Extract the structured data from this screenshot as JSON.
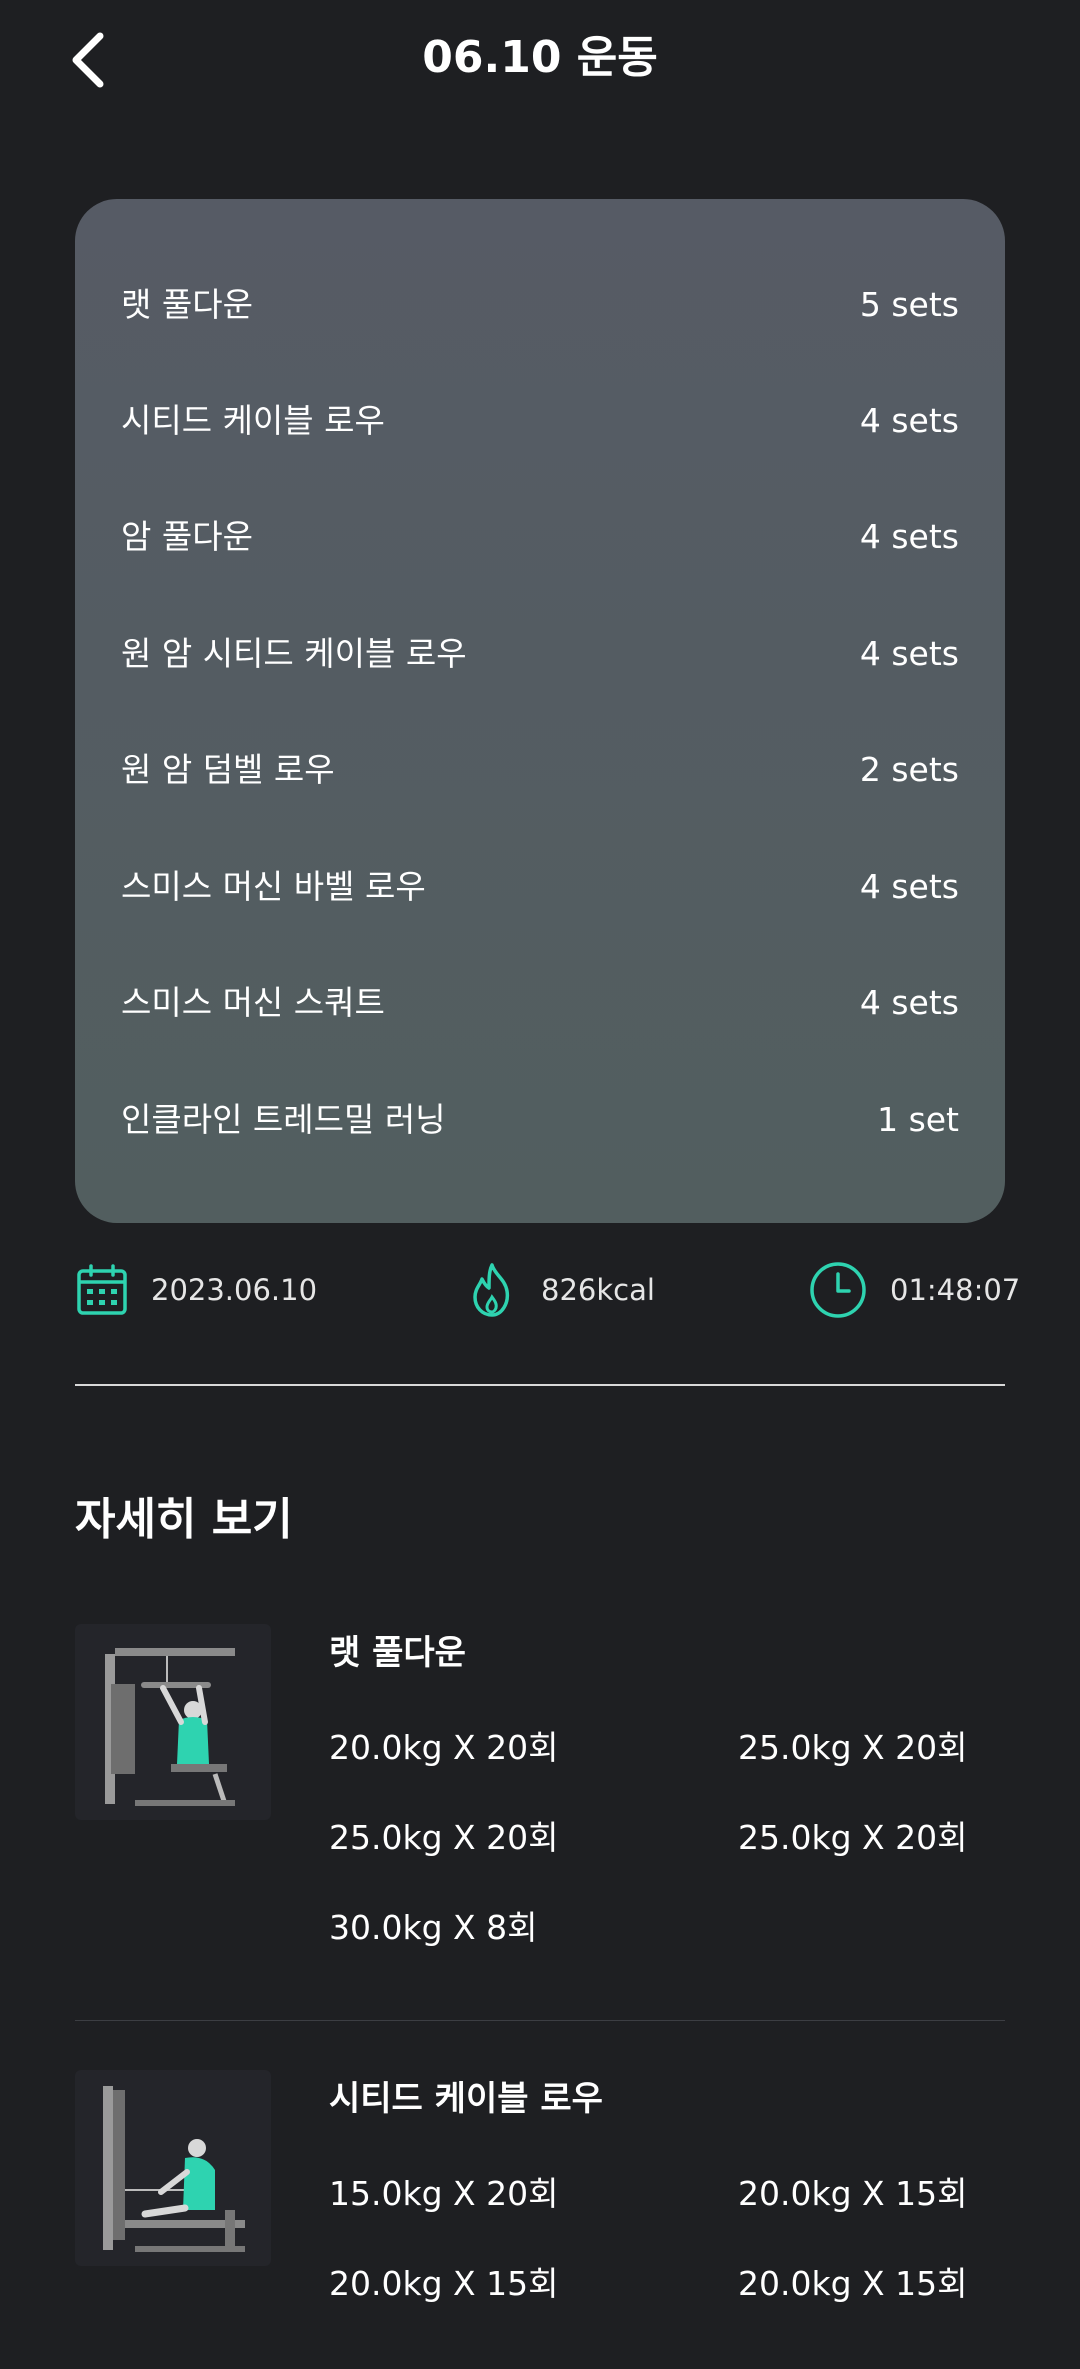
{
  "header": {
    "title": "06.10 운동"
  },
  "summary": [
    {
      "name": "랫 풀다운",
      "sets": "5 sets"
    },
    {
      "name": "시티드 케이블 로우",
      "sets": "4 sets"
    },
    {
      "name": "암 풀다운",
      "sets": "4 sets"
    },
    {
      "name": "원 암 시티드 케이블 로우",
      "sets": "4 sets"
    },
    {
      "name": "원 암 덤벨 로우",
      "sets": "2 sets"
    },
    {
      "name": "스미스 머신 바벨 로우",
      "sets": "4 sets"
    },
    {
      "name": "스미스 머신 스쿼트",
      "sets": "4 sets"
    },
    {
      "name": "인클라인 트레드밀 러닝",
      "sets": "1 set"
    }
  ],
  "stats": {
    "date": "2023.06.10",
    "calories": "826kcal",
    "duration": "01:48:07",
    "icons": [
      "calendar-icon",
      "flame-icon",
      "clock-icon"
    ],
    "accent_color": "#2ed3b0"
  },
  "details": {
    "title": "자세히 보기",
    "exercises": [
      {
        "name": "랫 풀다운",
        "sets": [
          "20.0kg X 20회",
          "25.0kg X 20회",
          "25.0kg X 20회",
          "25.0kg X 20회",
          "30.0kg X 8회"
        ]
      },
      {
        "name": "시티드 케이블 로우",
        "sets": [
          "15.0kg X 20회",
          "20.0kg X 15회",
          "20.0kg X 15회",
          "20.0kg X 15회"
        ]
      }
    ]
  }
}
